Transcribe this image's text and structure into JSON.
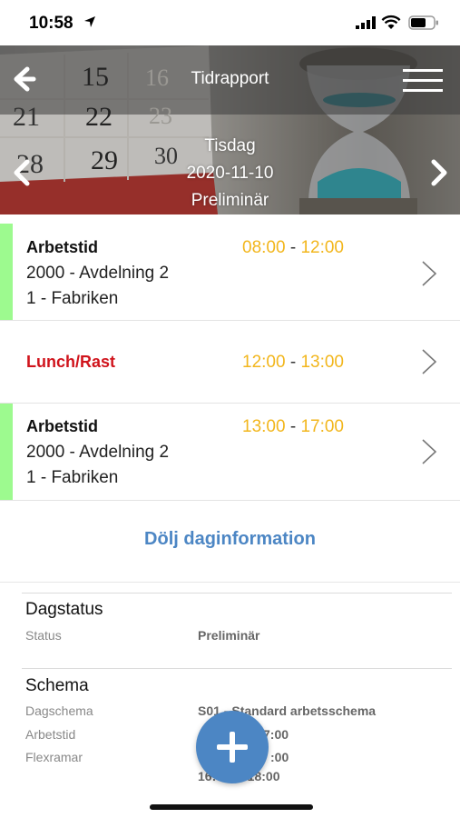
{
  "status_bar": {
    "time": "10:58"
  },
  "header": {
    "title": "Tidrapport",
    "weekday": "Tisdag",
    "date": "2020-11-10",
    "status": "Preliminär",
    "calendar_numbers": [
      "15",
      "16",
      "21",
      "22",
      "23",
      "28",
      "29",
      "30"
    ]
  },
  "entries": [
    {
      "type": "Arbetstid",
      "start": "08:00",
      "sep": " - ",
      "end": "12:00",
      "line1": "2000 - Avdelning 2",
      "line2": "1 - Fabriken",
      "has_bar": true
    },
    {
      "type": "Lunch/Rast",
      "start": "12:00",
      "sep": " - ",
      "end": "13:00",
      "has_bar": false
    },
    {
      "type": "Arbetstid",
      "start": "13:00",
      "sep": " - ",
      "end": "17:00",
      "line1": "2000 - Avdelning 2",
      "line2": "1 - Fabriken",
      "has_bar": true
    }
  ],
  "toggle_label": "Dölj daginformation",
  "dagstatus": {
    "title": "Dagstatus",
    "status_label": "Status",
    "status_value": "Preliminär"
  },
  "schema": {
    "title": "Schema",
    "dagschema_label": "Dagschema",
    "dagschema_value": "S01 - Standard arbetsschema",
    "arbetstid_label": "Arbetstid",
    "arbetstid_value_visible": "7:00",
    "flexramar_label": "Flexramar",
    "flexramar_value_visible": ":00",
    "flex_extra_visible": "16:",
    "flex_extra_end": " - 18:00"
  },
  "colors": {
    "accent_blue": "#4c86c4",
    "time_yellow": "#f2b61c",
    "lunch_red": "#d0141c",
    "bar_green": "#9dfa8f"
  },
  "icons": {
    "back": "arrow-left-icon",
    "menu": "hamburger-menu-icon",
    "prev": "chevron-left-icon",
    "next": "chevron-right-icon",
    "row": "chevron-right-thin-icon",
    "fab": "plus-icon"
  }
}
